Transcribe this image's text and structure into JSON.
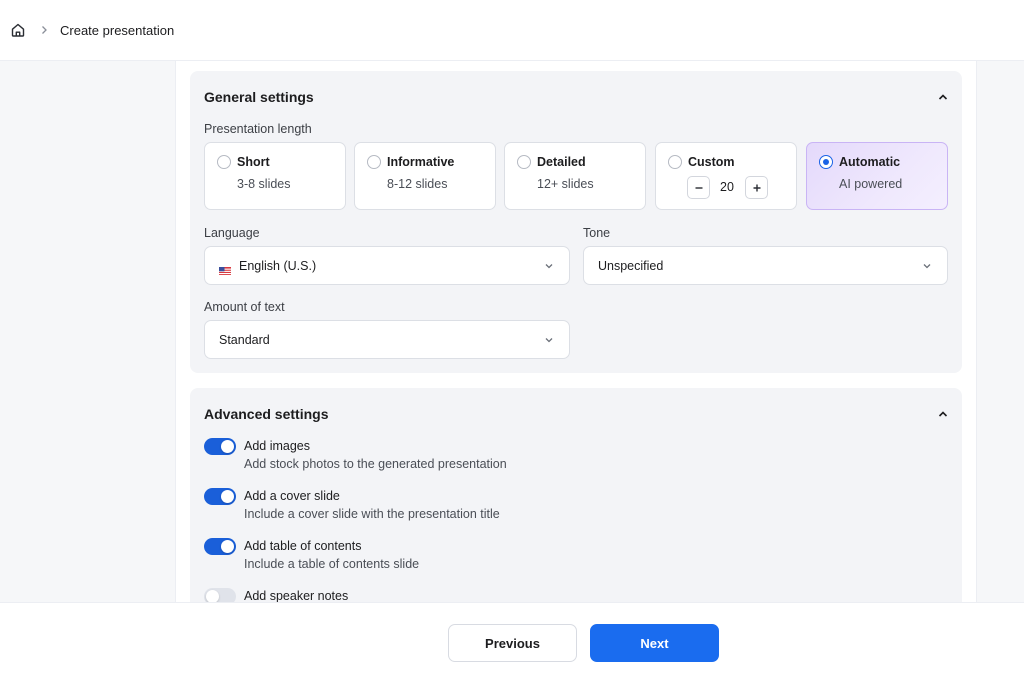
{
  "breadcrumb": {
    "home_icon": "home-icon",
    "current": "Create presentation"
  },
  "general": {
    "title": "General settings",
    "presentation_length": {
      "label": "Presentation length",
      "options": [
        {
          "title": "Short",
          "subtitle": "3-8 slides",
          "selected": false
        },
        {
          "title": "Informative",
          "subtitle": "8-12 slides",
          "selected": false
        },
        {
          "title": "Detailed",
          "subtitle": "12+ slides",
          "selected": false
        },
        {
          "title": "Custom",
          "value": "20",
          "selected": false
        },
        {
          "title": "Automatic",
          "subtitle": "AI powered",
          "selected": true
        }
      ]
    },
    "language": {
      "label": "Language",
      "value": "English (U.S.)",
      "flag_icon": "us-flag-icon"
    },
    "tone": {
      "label": "Tone",
      "value": "Unspecified"
    },
    "amount_of_text": {
      "label": "Amount of text",
      "value": "Standard"
    }
  },
  "advanced": {
    "title": "Advanced settings",
    "toggles": [
      {
        "title": "Add images",
        "subtitle": "Add stock photos to the generated presentation",
        "on": true
      },
      {
        "title": "Add a cover slide",
        "subtitle": "Include a cover slide with the presentation title",
        "on": true
      },
      {
        "title": "Add table of contents",
        "subtitle": "Include a table of contents slide",
        "on": true
      },
      {
        "title": "Add speaker notes",
        "subtitle": "",
        "on": false
      }
    ]
  },
  "footer": {
    "previous_label": "Previous",
    "next_label": "Next"
  },
  "colors": {
    "primary": "#1a6cef",
    "toggle_on": "#1a5fd9",
    "selected_card_border": "#c9b4f5",
    "panel_bg": "#f3f4f7"
  }
}
